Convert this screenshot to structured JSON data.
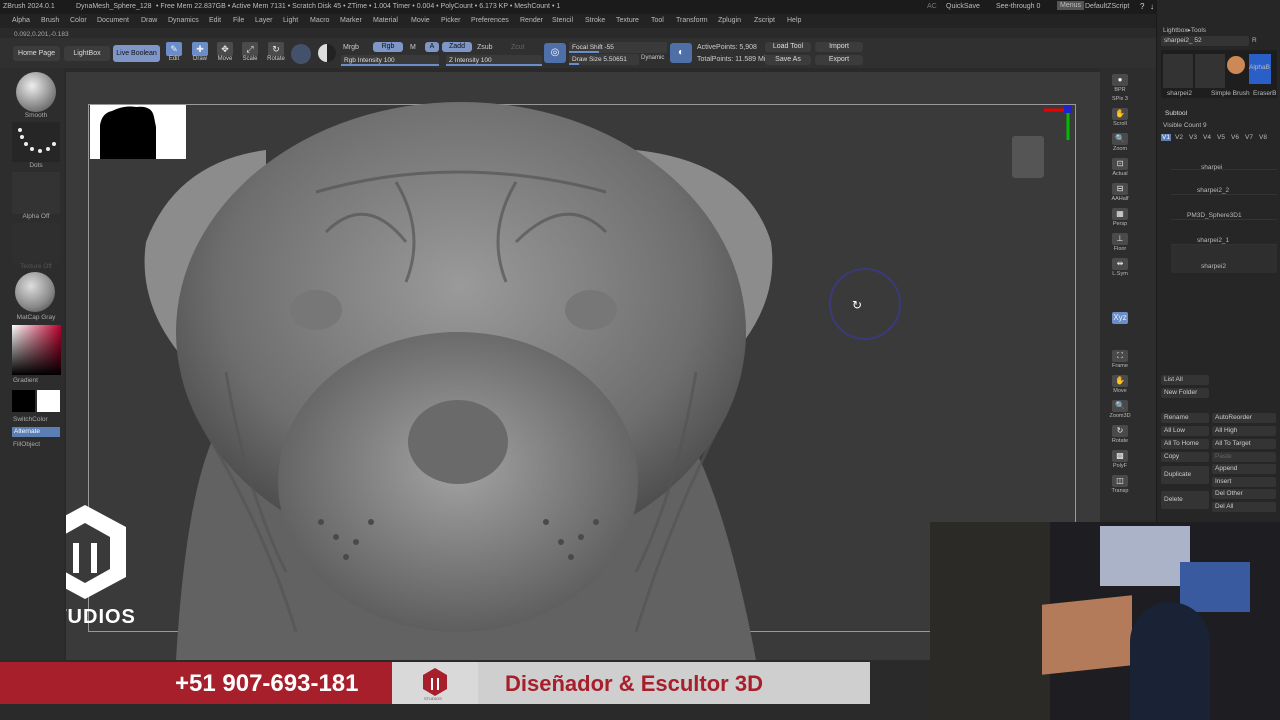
{
  "titlebar": {
    "app": "ZBrush 2024.0.1",
    "tool": "DynaMesh_Sphere_128",
    "stats": "• Free Mem 22.837GB • Active Mem 7131 • Scratch Disk 45 • ZTime • 1.004 Timer • 0.004 • PolyCount • 6.173 KP • MeshCount • 1",
    "ac": "AC",
    "quicksave": "QuickSave",
    "seethrough": "See-through  0",
    "menus": "Menus",
    "script": "DefaultZScript",
    "controls": [
      "?",
      "↓",
      "↑",
      "–",
      "▫",
      "✕"
    ]
  },
  "menubar": [
    "Alpha",
    "Brush",
    "Color",
    "Document",
    "Draw",
    "Dynamics",
    "Edit",
    "File",
    "Layer",
    "Light",
    "Macro",
    "Marker",
    "Material",
    "Movie",
    "Picker",
    "Preferences",
    "Render",
    "Stencil",
    "Stroke",
    "Texture",
    "Tool",
    "Transform",
    "Zplugin",
    "Zscript",
    "Help"
  ],
  "coords": "0.092,0.201,-0.183",
  "topshelf": {
    "home": "Home Page",
    "lightbox": "LightBox",
    "liveboolean": "Live Boolean",
    "edit": "Edit",
    "draw": "Draw",
    "move": "Move",
    "scale": "Scale",
    "rotate": "Rotate",
    "mrgb": "Mrgb",
    "rgb": "Rgb",
    "m": "M",
    "a": "A",
    "zadd": "Zadd",
    "zsub": "Zsub",
    "zcut": "Zcut",
    "rgb_intensity": "Rgb Intensity 100",
    "z_intensity": "Z Intensity 100",
    "focal_shift": "Focal Shift -55",
    "draw_size": "Draw Size 5.50651",
    "dynamic": "Dynamic",
    "active_points": "ActivePoints: 5,908",
    "total_points": "TotalPoints: 11.589 Mil",
    "load_tool": "Load Tool",
    "save_as": "Save As",
    "import": "Import",
    "export": "Export"
  },
  "leftshelf": {
    "smooth": "Smooth",
    "dots": "Dots",
    "alpha_off": "Alpha Off",
    "texture_off": "Texture Off",
    "matcap": "MatCap Gray",
    "gradient": "Gradient",
    "switchcolor": "SwitchColor",
    "alternate": "Alternate",
    "fillobject": "FillObject"
  },
  "rightshelf": [
    "BPR",
    "SPix 3",
    "Scroll",
    "Zoom",
    "Actual",
    "AAHalf",
    "Persp",
    "Floor",
    "L.Sym",
    "Xyz",
    "Frame",
    "Move",
    "Zoom3D",
    "Rotate",
    "PolyF",
    "Transp"
  ],
  "rightpanel": {
    "lightbox_tools": "Lightbox▸Tools",
    "tool_name": "sharpei2_ 52",
    "r": "R",
    "thumbs": [
      "sharpei2",
      "Simple Brush",
      "EraserB",
      "AlphaB"
    ],
    "subtool_title": "Subtool",
    "visible_count": "Visible Count 9",
    "v_buttons": [
      "V1",
      "V2",
      "V3",
      "V4",
      "V5",
      "V6",
      "V7",
      "V8"
    ],
    "subtools": [
      "sharpei",
      "sharpei2_2",
      "PM3D_Sphere3D1",
      "sharpei2_1",
      "sharpei2"
    ],
    "list_all": "List All",
    "new_folder": "New Folder",
    "rename": "Rename",
    "autoreorder": "AutoReorder",
    "all_low": "All Low",
    "all_high": "All High",
    "all_to_home": "All To Home",
    "all_to_target": "All To Target",
    "copy": "Copy",
    "paste": "Paste",
    "duplicate": "Duplicate",
    "append": "Append",
    "insert": "Insert",
    "delete": "Delete",
    "del_other": "Del Other",
    "del_all": "Del All"
  },
  "studio": "STUDIOS",
  "banner": {
    "phone": "+51 907-693-181",
    "title": "Diseñador & Escultor 3D",
    "logo_small": "STUDIOS"
  }
}
